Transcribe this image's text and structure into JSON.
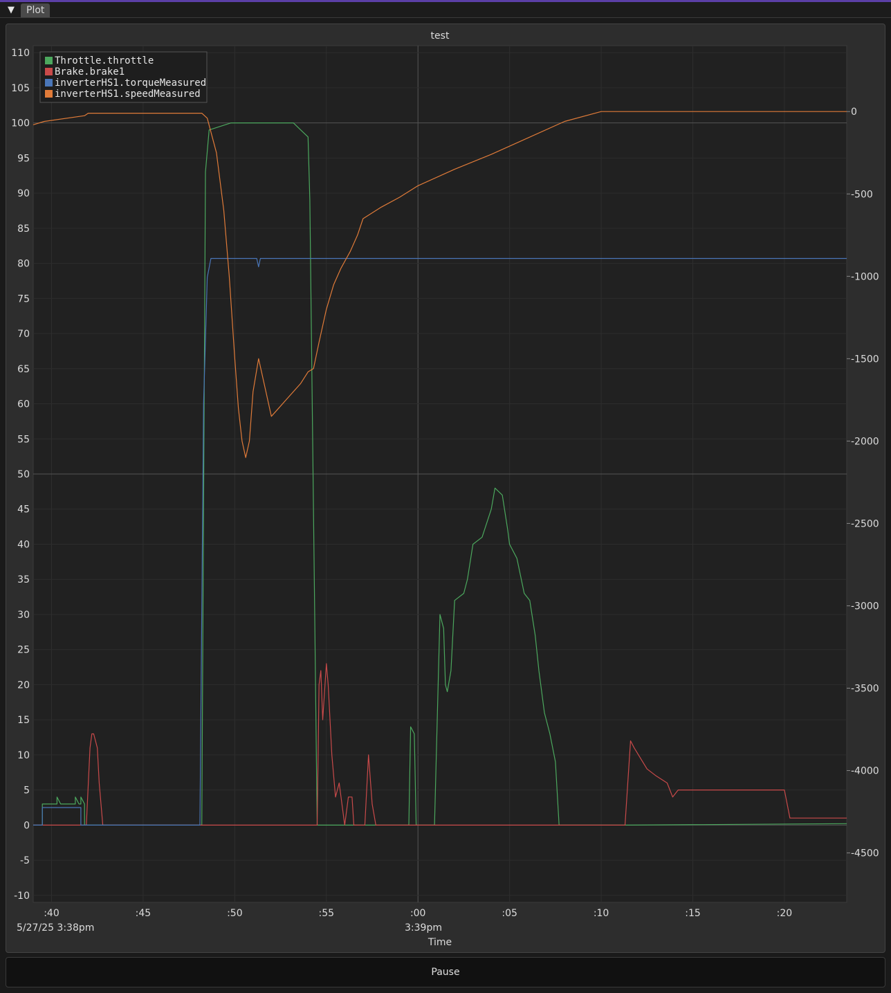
{
  "window": {
    "tab_label": "Plot",
    "collapse_glyph": "▼"
  },
  "plot": {
    "title": "test",
    "x_axis_label": "Time",
    "date_label_left": "5/27/25 3:38pm",
    "date_label_center": "3:39pm",
    "x_ticks": [
      ":40",
      ":45",
      ":50",
      ":55",
      ":00",
      ":05",
      ":10",
      ":15",
      ":20"
    ],
    "y_left_ticks": [
      "110",
      "105",
      "100",
      "95",
      "90",
      "85",
      "80",
      "75",
      "70",
      "65",
      "60",
      "55",
      "50",
      "45",
      "40",
      "35",
      "30",
      "25",
      "20",
      "15",
      "10",
      "5",
      "0",
      "-5",
      "-10"
    ],
    "y_right_ticks": [
      "-4500",
      "-4000",
      "-3500",
      "-3000",
      "-2500",
      "-2000",
      "-1500",
      "-1000",
      "-500",
      "0"
    ],
    "legend": [
      {
        "name": "Throttle.throttle",
        "color": "#4ca85e"
      },
      {
        "name": "Brake.brake1",
        "color": "#c94a4a"
      },
      {
        "name": "inverterHS1.torqueMeasured",
        "color": "#4a76b8"
      },
      {
        "name": "inverterHS1.speedMeasured",
        "color": "#e07b39"
      }
    ]
  },
  "chart_data": {
    "type": "line",
    "x_unit": "seconds past 3:38:00pm, 5/27/25",
    "xlim": [
      39,
      83.4
    ],
    "ylim_left": [
      -11,
      111
    ],
    "ylim_right": [
      4800,
      -400
    ],
    "series": [
      {
        "name": "Throttle.throttle",
        "axis": "left",
        "points": [
          [
            39,
            0
          ],
          [
            39.5,
            0
          ],
          [
            39.5,
            3
          ],
          [
            40.3,
            3
          ],
          [
            40.3,
            4
          ],
          [
            40.5,
            3
          ],
          [
            41.3,
            3
          ],
          [
            41.3,
            4
          ],
          [
            41.5,
            3
          ],
          [
            41.6,
            3
          ],
          [
            41.6,
            4
          ],
          [
            41.8,
            3
          ],
          [
            41.8,
            0
          ],
          [
            48.2,
            0
          ],
          [
            48.4,
            93
          ],
          [
            48.6,
            99
          ],
          [
            49.8,
            100
          ],
          [
            51.5,
            100
          ],
          [
            53.2,
            100
          ],
          [
            53.6,
            99
          ],
          [
            54,
            98
          ],
          [
            54.1,
            89
          ],
          [
            54.5,
            0
          ],
          [
            59.5,
            0
          ],
          [
            59.6,
            14
          ],
          [
            59.8,
            13
          ],
          [
            59.9,
            0
          ],
          [
            60.9,
            0
          ],
          [
            61.2,
            30
          ],
          [
            61.4,
            28
          ],
          [
            61.5,
            20
          ],
          [
            61.6,
            19
          ],
          [
            61.8,
            22
          ],
          [
            62,
            32
          ],
          [
            62.5,
            33
          ],
          [
            62.7,
            35
          ],
          [
            63,
            40
          ],
          [
            63.5,
            41
          ],
          [
            64,
            45
          ],
          [
            64.2,
            48
          ],
          [
            64.6,
            47
          ],
          [
            64.9,
            42
          ],
          [
            65,
            40
          ],
          [
            65.4,
            38
          ],
          [
            65.8,
            33
          ],
          [
            66.1,
            32
          ],
          [
            66.4,
            27
          ],
          [
            66.6,
            22
          ],
          [
            66.9,
            16
          ],
          [
            67.2,
            13
          ],
          [
            67.5,
            9
          ],
          [
            67.7,
            0
          ],
          [
            71.3,
            0
          ],
          [
            83.4,
            0.2
          ]
        ]
      },
      {
        "name": "Brake.brake1",
        "axis": "left",
        "points": [
          [
            39,
            0
          ],
          [
            41.9,
            0
          ],
          [
            42.1,
            11
          ],
          [
            42.2,
            13
          ],
          [
            42.3,
            13
          ],
          [
            42.5,
            11
          ],
          [
            42.6,
            6
          ],
          [
            42.8,
            0
          ],
          [
            54.5,
            0
          ],
          [
            54.6,
            20
          ],
          [
            54.7,
            22
          ],
          [
            54.8,
            15
          ],
          [
            55,
            23
          ],
          [
            55.1,
            20
          ],
          [
            55.3,
            10
          ],
          [
            55.5,
            4
          ],
          [
            55.7,
            6
          ],
          [
            56,
            0
          ],
          [
            56.2,
            4
          ],
          [
            56.4,
            4
          ],
          [
            56.5,
            0
          ],
          [
            57.1,
            0
          ],
          [
            57.3,
            10
          ],
          [
            57.5,
            3
          ],
          [
            57.7,
            0
          ],
          [
            71.3,
            0
          ],
          [
            71.6,
            12
          ],
          [
            71.8,
            11
          ],
          [
            72.5,
            8
          ],
          [
            73,
            7
          ],
          [
            73.6,
            6
          ],
          [
            73.9,
            4
          ],
          [
            74.2,
            5
          ],
          [
            80,
            5
          ],
          [
            80.3,
            1
          ],
          [
            80.6,
            1
          ],
          [
            83.4,
            1
          ]
        ]
      },
      {
        "name": "inverterHS1.torqueMeasured",
        "axis": "left",
        "points": [
          [
            39,
            0
          ],
          [
            39.5,
            0
          ],
          [
            39.5,
            2.5
          ],
          [
            41.6,
            2.5
          ],
          [
            41.6,
            0
          ],
          [
            48.1,
            0
          ],
          [
            48.3,
            60
          ],
          [
            48.5,
            78
          ],
          [
            48.7,
            80.7
          ],
          [
            51.2,
            80.7
          ],
          [
            51.3,
            79.5
          ],
          [
            51.4,
            80.7
          ],
          [
            83.4,
            80.7
          ]
        ]
      },
      {
        "name": "inverterHS1.speedMeasured",
        "axis": "right",
        "points": [
          [
            39,
            80
          ],
          [
            39.6,
            60
          ],
          [
            41.8,
            25
          ],
          [
            42,
            10
          ],
          [
            48.2,
            10
          ],
          [
            48.5,
            40
          ],
          [
            49,
            250
          ],
          [
            49.4,
            600
          ],
          [
            49.7,
            1000
          ],
          [
            50,
            1500
          ],
          [
            50.2,
            1800
          ],
          [
            50.4,
            2000
          ],
          [
            50.6,
            2100
          ],
          [
            50.8,
            2000
          ],
          [
            51,
            1700
          ],
          [
            51.3,
            1500
          ],
          [
            51.7,
            1700
          ],
          [
            52,
            1850
          ],
          [
            52.4,
            1800
          ],
          [
            52.8,
            1750
          ],
          [
            53.2,
            1700
          ],
          [
            53.6,
            1650
          ],
          [
            54,
            1580
          ],
          [
            54.3,
            1560
          ],
          [
            54.6,
            1400
          ],
          [
            55,
            1200
          ],
          [
            55.4,
            1050
          ],
          [
            55.8,
            950
          ],
          [
            56.3,
            850
          ],
          [
            56.7,
            750
          ],
          [
            57,
            650
          ],
          [
            58,
            580
          ],
          [
            59,
            520
          ],
          [
            60,
            450
          ],
          [
            62,
            350
          ],
          [
            64,
            260
          ],
          [
            66,
            160
          ],
          [
            68,
            60
          ],
          [
            70,
            0
          ],
          [
            71.3,
            0
          ],
          [
            83.4,
            0
          ]
        ]
      }
    ]
  },
  "pause_label": "Pause"
}
